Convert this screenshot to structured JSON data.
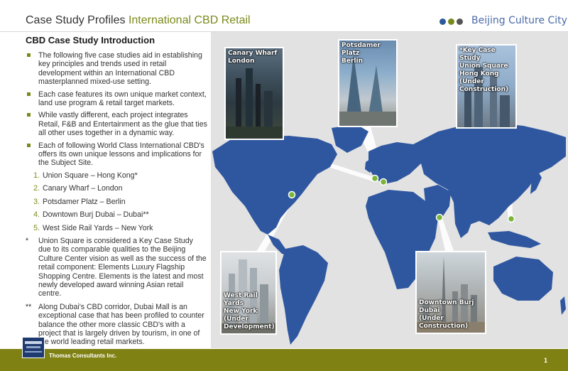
{
  "header": {
    "title_main": "Case Study Profiles ",
    "title_accent": "International CBD Retail",
    "brand": "Beijing Culture City",
    "dot_colors": [
      "#2d5b9a",
      "#7a8a1a",
      "#555555"
    ]
  },
  "intro": {
    "heading": "CBD Case Study Introduction",
    "bullets": [
      "The following five case studies aid in establishing key principles and trends used in retail development within an International CBD masterplanned mixed-use setting.",
      "Each case features its own unique market context, land use program & retail target markets.",
      "While vastly different, each project integrates Retail, F&B and Entertainment as the glue that ties all other uses together in a dynamic way.",
      "Each of following World Class International CBD's offers its own unique lessons and implications for the Subject Site."
    ],
    "list": [
      {
        "num": "1.",
        "text": "Union Square – Hong Kong*"
      },
      {
        "num": "2.",
        "text": "Canary Wharf – London"
      },
      {
        "num": "3.",
        "text": "Potsdamer Platz – Berlin"
      },
      {
        "num": "4.",
        "text": "Downtown Burj Dubai – Dubai**"
      },
      {
        "num": "5.",
        "text": "West Side Rail Yards – New York"
      }
    ],
    "notes": [
      {
        "mark": "*",
        "text": "Union Square is considered a Key Case Study due to its comparable qualities to the Beijing Culture Center vision as well as the success of the retail component: Elements Luxury Flagship Shopping Centre. Elements is the latest and most newly developed award winning Asian retail centre."
      },
      {
        "mark": "**",
        "text": "Along Dubai's CBD corridor, Dubai Mall is an exceptional case that has been profiled to counter balance the other more classic CBD's with a project that is largely driven by tourism, in one of the world leading retail markets."
      }
    ]
  },
  "map": {
    "ocean_color": "#e2e2e2",
    "land_color": "#2f57a0",
    "marker_color": "#7ab53a"
  },
  "photos": {
    "canary": {
      "line1": "Canary Wharf",
      "line2": "London"
    },
    "potsdamer": {
      "line1": "Potsdamer Platz",
      "line2": "Berlin"
    },
    "union": {
      "line1": "*Key Case Study",
      "line2": "Union Square",
      "line3": "Hong Kong",
      "line4": "(Under",
      "line5": "Construction)"
    },
    "westrail": {
      "line1": "West Rail Yards",
      "line2": "New York",
      "line3": "(Under",
      "line4": "Development)"
    },
    "burj": {
      "line1": "Downtown Burj Dubai",
      "line2": "(Under Construction)"
    }
  },
  "footer": {
    "company": "Thomas Consultants Inc.",
    "page": "1"
  }
}
